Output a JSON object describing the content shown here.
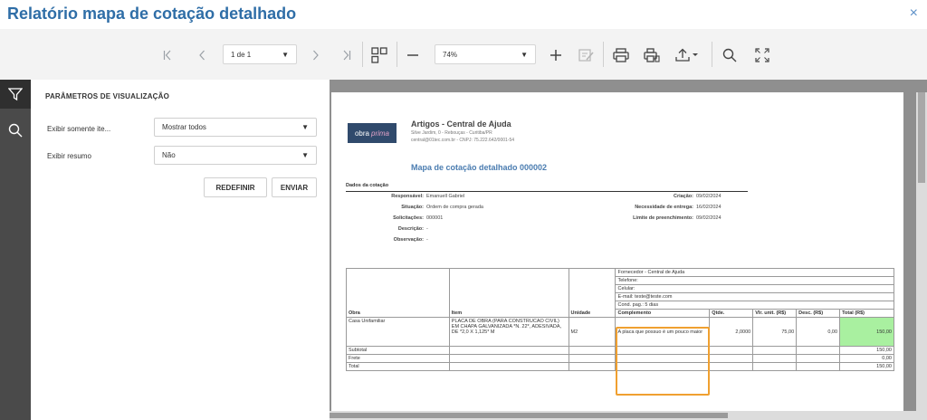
{
  "window": {
    "title": "Relatório mapa de cotação detalhado",
    "close_glyph": "×"
  },
  "toolbar": {
    "page_value": "1 de 1",
    "zoom_value": "74%"
  },
  "panel": {
    "title": "PARÂMETROS DE VISUALIZAÇÃO",
    "fields": [
      {
        "label": "Exibir somente ite...",
        "value": "Mostrar todos"
      },
      {
        "label": "Exibir resumo",
        "value": "Não"
      }
    ],
    "reset_label": "REDEFINIR",
    "send_label": "ENVIAR"
  },
  "report": {
    "logo_part1": "obra",
    "logo_part2": "prima",
    "org_name": "Artigos - Central de Ajuda",
    "org_address": "Silve Jardim, 0 - Rebouças - Curitiba/PR",
    "org_contact": "central@01tec.com.br - CNPJ: 75.222.642/0001-54",
    "title": "Mapa de cotação detalhado 000002",
    "section_title": "Dados da cotação",
    "left_fields": [
      {
        "key": "Responsável:",
        "value": "Emanuell Gabriel"
      },
      {
        "key": "Situação:",
        "value": "Ordem de compra gerada"
      },
      {
        "key": "Solicitações:",
        "value": "000001"
      },
      {
        "key": "Descrição:",
        "value": "-"
      },
      {
        "key": "Observação:",
        "value": "-"
      }
    ],
    "right_fields": [
      {
        "key": "Criação:",
        "value": "09/02/2024"
      },
      {
        "key": "Necessidade de entrega:",
        "value": "16/02/2024"
      },
      {
        "key": "Limite de preenchimento:",
        "value": "09/02/2024"
      }
    ],
    "supplier_lines": [
      "Fornecedor - Central de Ajuda",
      "Telefone:",
      "Celular:",
      "E-mail: teste@teste.com",
      "Cond. pag.: 5 dias"
    ],
    "headers": {
      "obra": "Obra",
      "item": "Item",
      "unidade": "Unidade",
      "complemento": "Complemento",
      "qtde": "Qtde.",
      "vlr_unit": "Vlr. unit. (R$)",
      "desc": "Desc. (R$)",
      "total": "Total (R$)"
    },
    "row": {
      "obra": "Casa Unifamiliar",
      "item": "PLACA DE OBRA (PARA CONSTRUCAO CIVIL) EM CHAPA GALVANIZADA *N. 22*, ADESIVADA, DE *2,0 X 1,125* M",
      "unidade": "M2",
      "complemento": "A placa que possuo é um pouco maior",
      "qtde": "2,0000",
      "vlr_unit": "75,00",
      "desc": "0,00",
      "total": "150,00"
    },
    "summary": [
      {
        "label": "Subtotal",
        "value": "150,00"
      },
      {
        "label": "Frete",
        "value": "0,00"
      },
      {
        "label": "Total",
        "value": "150,00"
      }
    ]
  }
}
